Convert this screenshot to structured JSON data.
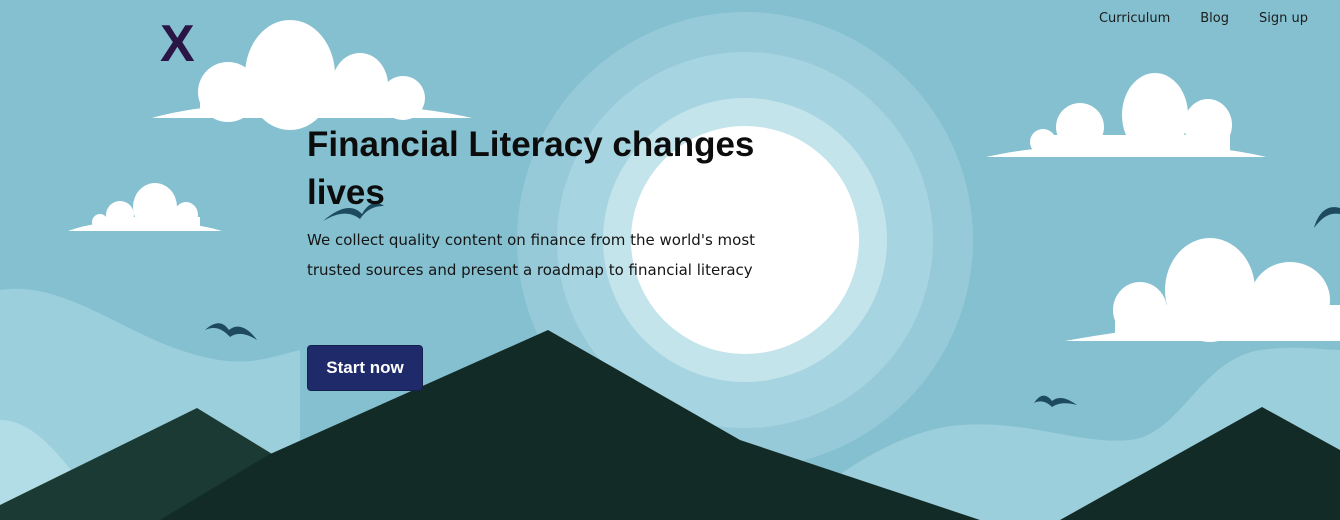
{
  "header": {
    "logo_text": "X",
    "nav": [
      {
        "label": "Curriculum"
      },
      {
        "label": "Blog"
      },
      {
        "label": "Sign up"
      }
    ]
  },
  "hero": {
    "title": "Financial Literacy changes lives",
    "description": "We collect quality content on finance from the world's most trusted sources and present a roadmap to financial literacy",
    "cta_label": "Start now"
  },
  "colors": {
    "sky": "#85c0d0",
    "sun": "#ffffff",
    "mountain_dark": "#132b27",
    "mountain_mid": "#1b3a33",
    "button": "#1f2a6b",
    "logo": "#2a1646"
  }
}
